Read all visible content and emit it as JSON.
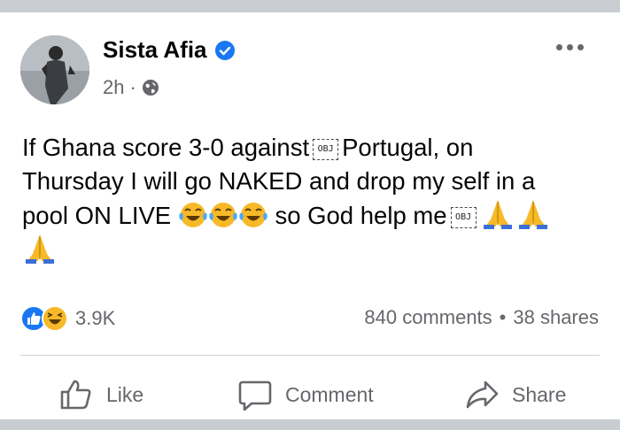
{
  "post": {
    "author": "Sista Afia",
    "time": "2h",
    "separator": "·",
    "text_line1_a": "If Ghana score 3-0 against",
    "text_line1_b": "Portugal, on",
    "text_line2": "Thursday I will go NAKED and drop my self in a",
    "text_line3_a": "pool ON LIVE",
    "text_line3_b": "so God help me",
    "obj_placeholder": "OBJ"
  },
  "engagement": {
    "reaction_count": "3.9K",
    "comments": "840 comments",
    "dot": "•",
    "shares": "38 shares"
  },
  "actions": {
    "like": "Like",
    "comment": "Comment",
    "share": "Share"
  },
  "colors": {
    "brand_blue": "#1877f2",
    "text_gray": "#65676b",
    "haha_yellow": "#f7b928"
  }
}
